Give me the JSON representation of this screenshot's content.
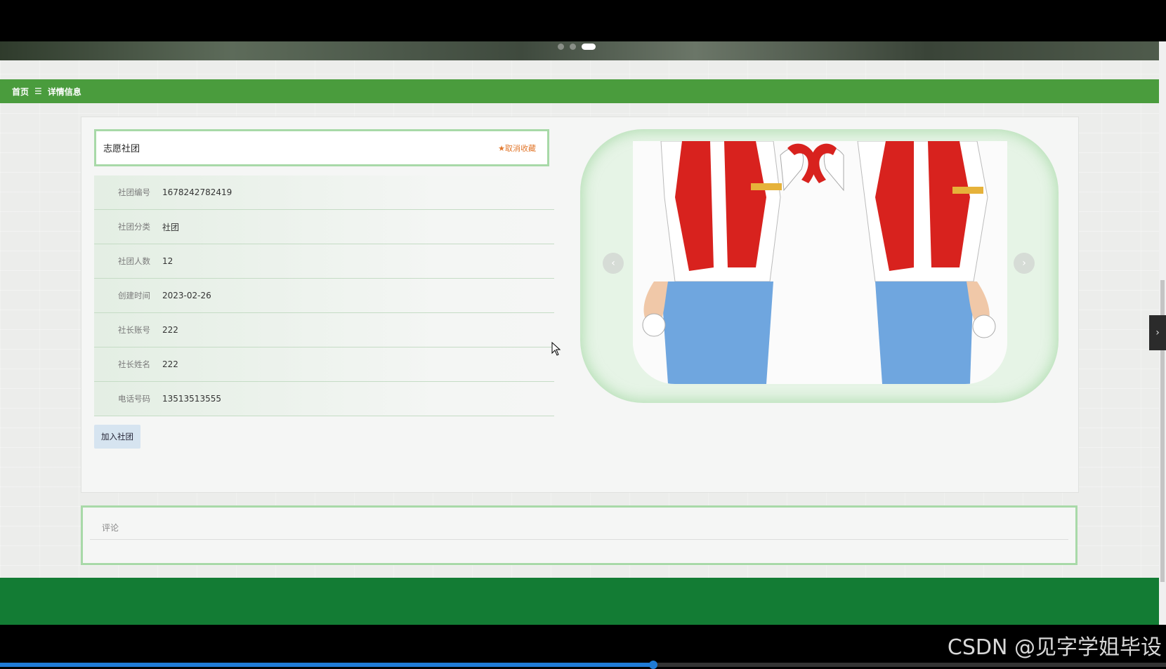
{
  "breadcrumb": {
    "home": "首页",
    "separator": "☰",
    "current": "详情信息"
  },
  "detail": {
    "title": "志愿社团",
    "favorite_label": "★取消收藏",
    "fields": [
      {
        "label": "社团编号",
        "value": "1678242782419"
      },
      {
        "label": "社团分类",
        "value": "社团"
      },
      {
        "label": "社团人数",
        "value": "12"
      },
      {
        "label": "创建时间",
        "value": "2023-02-26"
      },
      {
        "label": "社长账号",
        "value": "222"
      },
      {
        "label": "社长姓名",
        "value": "222"
      },
      {
        "label": "电话号码",
        "value": "13513513555"
      }
    ],
    "join_label": "加入社团"
  },
  "gallery": {
    "prev_icon": "‹",
    "next_icon": "›"
  },
  "comments": {
    "heading": "评论"
  },
  "side_toggle": "›",
  "watermark": "CSDN @见字学姐毕设",
  "video_progress_percent": 56,
  "colors": {
    "accent_green": "#4a9c3d",
    "footer_green": "#137c34",
    "border_green": "#a8d9a8",
    "favorite_orange": "#e2782d"
  }
}
